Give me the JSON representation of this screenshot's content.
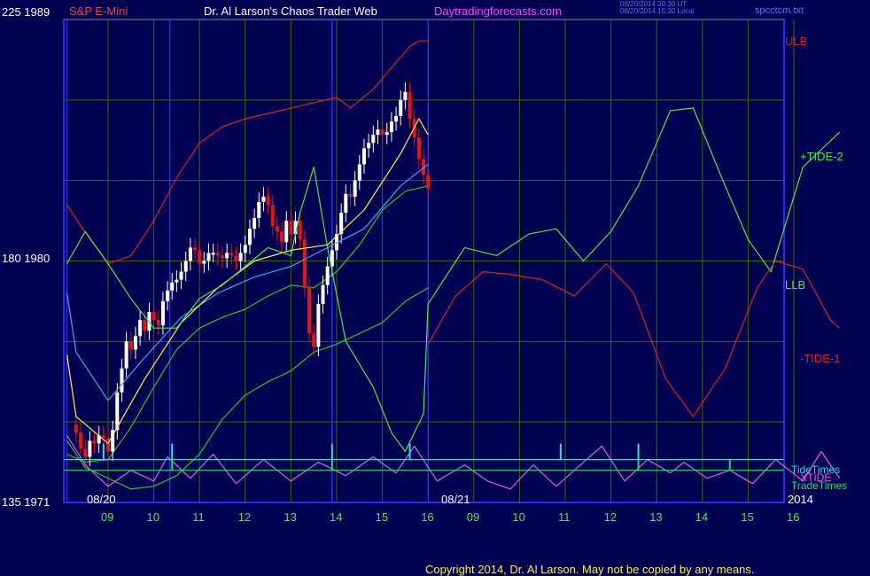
{
  "header": {
    "left_axis_top": "225  1989",
    "symbol": "S&P E-Mini",
    "site_title": "Dr. Al Larson's Chaos Trader Web",
    "site_url": "Daytradingforecasts.com",
    "timestamp_line1": "08/20/2014 20:30 UT",
    "timestamp_line2": "08/20/2014 15:30 Local",
    "file_name": "spcctcm.txt"
  },
  "axis": {
    "left_mid": "180  1980",
    "left_bottom": "135  1971",
    "date_start": "08/20",
    "date_mid": "08/21",
    "year": "2014",
    "hour_ticks": [
      "09",
      "10",
      "11",
      "12",
      "13",
      "14",
      "15",
      "16",
      "09",
      "10",
      "11",
      "12",
      "13",
      "14",
      "15",
      "16"
    ]
  },
  "right_labels": {
    "ulb": "ULB",
    "tide_plus": "+TIDE-2",
    "llb": "LLB",
    "tide_minus": "-TIDE-1",
    "tide_times": "TideTimes",
    "xtide": "XTIDE",
    "trade_times": "TradeTimes"
  },
  "footer": {
    "copyright": "Copyright 2014, Dr. Al Larson. May not be copied by any means."
  },
  "colors": {
    "background": "#000050",
    "border": "#2a2aff",
    "grid": "#3c6a00",
    "ulb": "#e02020",
    "llb": "#22cc22",
    "tide_plus": "#44ee44",
    "tide_minus": "#e02020",
    "xtide": "#ee55ee",
    "tide_times": "#33dddd",
    "trade_times": "#22dd66",
    "bar_up": "#ffffff",
    "bar_down": "#ee1111",
    "ma_fast": "#ffee44",
    "ma_slow": "#33aaff"
  },
  "chart_data": {
    "type": "line",
    "y_left_ticks": [
      "225  1989",
      "180  1980",
      "135  1971"
    ],
    "x_ticks": [
      "09",
      "10",
      "11",
      "12",
      "13",
      "14",
      "15",
      "16",
      "09",
      "10",
      "11",
      "12",
      "13",
      "14",
      "15",
      "16"
    ],
    "x_hour_index": [
      0,
      1,
      2,
      3,
      4,
      5,
      6,
      7,
      8,
      9,
      10,
      11,
      12,
      13,
      14,
      15
    ],
    "price": {
      "ylim": [
        1971,
        1989
      ],
      "candle_close_x": [
        -0.7,
        -0.6,
        -0.5,
        -0.4,
        -0.3,
        -0.2,
        -0.1,
        0.0,
        0.1,
        0.2,
        0.3,
        0.4,
        0.5,
        0.6,
        0.7,
        0.8,
        0.9,
        1.0,
        1.1,
        1.2,
        1.3,
        1.4,
        1.5,
        1.6,
        1.7,
        1.8,
        1.9,
        2.0,
        2.1,
        2.2,
        2.3,
        2.4,
        2.5,
        2.6,
        2.7,
        2.8,
        2.9,
        3.0,
        3.1,
        3.2,
        3.3,
        3.4,
        3.5,
        3.6,
        3.7,
        3.8,
        3.9,
        4.0,
        4.1,
        4.2,
        4.3,
        4.4,
        4.5,
        4.6,
        4.7,
        4.8,
        4.9,
        5.0,
        5.1,
        5.2,
        5.3,
        5.4,
        5.5,
        5.6,
        5.7,
        5.8,
        5.9,
        6.0,
        6.1,
        6.2,
        6.3,
        6.4,
        6.5,
        6.6,
        6.7,
        6.8,
        6.9,
        7.0
      ],
      "close": [
        1973.6,
        1973.0,
        1972.7,
        1973.3,
        1973.2,
        1973.5,
        1973.4,
        1972.9,
        1973.7,
        1975.1,
        1976.0,
        1977.0,
        1976.7,
        1977.2,
        1977.8,
        1977.4,
        1978.1,
        1977.8,
        1977.6,
        1978.5,
        1978.9,
        1979.2,
        1979.3,
        1979.6,
        1980.0,
        1980.5,
        1980.4,
        1979.9,
        1980.0,
        1980.3,
        1980.3,
        1980.2,
        1980.1,
        1980.3,
        1980.2,
        1980.0,
        1980.3,
        1980.6,
        1981.2,
        1981.6,
        1982.2,
        1982.4,
        1982.1,
        1981.3,
        1981.1,
        1980.7,
        1981.5,
        1981.0,
        1981.5,
        1980.8,
        1979.0,
        1977.3,
        1976.8,
        1978.4,
        1979.1,
        1979.8,
        1980.4,
        1981.0,
        1981.8,
        1982.5,
        1982.4,
        1983.0,
        1983.6,
        1984.2,
        1984.4,
        1984.7,
        1984.9,
        1984.7,
        1984.8,
        1985.2,
        1985.4,
        1986.0,
        1986.3,
        1985.3,
        1984.6,
        1983.8,
        1983.2,
        1982.7
      ],
      "ma_fast": [
        [
          -0.9,
          1976.5
        ],
        [
          -0.7,
          1974.2
        ],
        [
          0.0,
          1973.2
        ],
        [
          0.8,
          1975.6
        ],
        [
          1.6,
          1977.7
        ],
        [
          2.4,
          1979.0
        ],
        [
          3.2,
          1980.0
        ],
        [
          4.0,
          1980.4
        ],
        [
          4.8,
          1980.6
        ],
        [
          5.6,
          1981.9
        ],
        [
          6.4,
          1984.0
        ],
        [
          6.8,
          1985.3
        ],
        [
          7.0,
          1984.7
        ]
      ],
      "ma_slow": [
        [
          -0.9,
          1978.8
        ],
        [
          -0.7,
          1976.6
        ],
        [
          0.0,
          1974.8
        ],
        [
          0.8,
          1976.4
        ],
        [
          1.6,
          1977.9
        ],
        [
          2.4,
          1978.8
        ],
        [
          3.2,
          1979.4
        ],
        [
          4.0,
          1979.8
        ],
        [
          4.8,
          1980.5
        ],
        [
          5.6,
          1981.2
        ],
        [
          6.4,
          1982.8
        ],
        [
          7.0,
          1983.6
        ]
      ]
    },
    "bands": {
      "ulb": [
        [
          -0.9,
          1982.1
        ],
        [
          -0.6,
          1981.3
        ],
        [
          0.0,
          1979.9
        ],
        [
          0.5,
          1980.2
        ],
        [
          1.0,
          1981.5
        ],
        [
          1.5,
          1983.1
        ],
        [
          2.0,
          1984.4
        ],
        [
          2.5,
          1985.0
        ],
        [
          3.0,
          1985.3
        ],
        [
          3.5,
          1985.5
        ],
        [
          4.0,
          1985.7
        ],
        [
          4.5,
          1985.9
        ],
        [
          5.0,
          1986.1
        ],
        [
          5.3,
          1985.7
        ],
        [
          5.8,
          1986.4
        ],
        [
          6.2,
          1987.2
        ],
        [
          6.6,
          1988.0
        ],
        [
          6.8,
          1988.2
        ],
        [
          7.0,
          1988.2
        ]
      ],
      "llb_upper": [
        [
          -0.9,
          1972.8
        ],
        [
          -0.5,
          1972.5
        ],
        [
          0.0,
          1972.6
        ],
        [
          0.5,
          1973.8
        ],
        [
          1.0,
          1975.3
        ],
        [
          1.5,
          1976.7
        ],
        [
          2.0,
          1977.5
        ],
        [
          2.5,
          1977.9
        ],
        [
          3.0,
          1978.2
        ],
        [
          3.5,
          1978.7
        ],
        [
          4.0,
          1979.1
        ],
        [
          4.5,
          1979.0
        ],
        [
          5.0,
          1979.6
        ],
        [
          5.5,
          1980.6
        ],
        [
          6.0,
          1981.9
        ],
        [
          6.5,
          1982.6
        ],
        [
          7.0,
          1982.8
        ]
      ],
      "llb_lower": [
        [
          -0.9,
          1973.3
        ],
        [
          -0.5,
          1972.3
        ],
        [
          0.0,
          1971.9
        ],
        [
          0.5,
          1971.5
        ],
        [
          1.0,
          1971.6
        ],
        [
          1.5,
          1972.0
        ],
        [
          2.0,
          1972.8
        ],
        [
          2.5,
          1974.1
        ],
        [
          3.0,
          1975.0
        ],
        [
          3.5,
          1975.5
        ],
        [
          4.0,
          1975.9
        ],
        [
          4.5,
          1976.6
        ],
        [
          5.0,
          1976.9
        ],
        [
          5.5,
          1977.3
        ],
        [
          6.0,
          1977.7
        ],
        [
          6.5,
          1978.5
        ],
        [
          7.0,
          1979.0
        ]
      ]
    },
    "tide_plus_2": [
      [
        -0.9,
        1979.9
      ],
      [
        -0.5,
        1981.1
      ],
      [
        0.0,
        1979.9
      ],
      [
        0.5,
        1978.6
      ],
      [
        1.0,
        1977.5
      ],
      [
        1.5,
        1977.5
      ],
      [
        2.0,
        1978.6
      ],
      [
        2.5,
        1979.1
      ],
      [
        3.0,
        1979.8
      ],
      [
        3.5,
        1980.5
      ],
      [
        4.0,
        1980.2
      ],
      [
        4.2,
        1981.8
      ],
      [
        4.5,
        1983.5
      ],
      [
        4.8,
        1980.5
      ],
      [
        5.2,
        1977.0
      ],
      [
        5.8,
        1975.3
      ],
      [
        6.2,
        1973.6
      ],
      [
        6.5,
        1972.9
      ],
      [
        6.9,
        1974.3
      ],
      [
        7.0,
        1978.4
      ],
      [
        7.8,
        1980.5
      ],
      [
        8.5,
        1980.2
      ],
      [
        9.2,
        1981.0
      ],
      [
        9.8,
        1981.2
      ],
      [
        10.4,
        1980.0
      ],
      [
        11.0,
        1981.1
      ],
      [
        11.6,
        1982.8
      ],
      [
        12.3,
        1985.6
      ],
      [
        12.8,
        1985.7
      ],
      [
        13.4,
        1983.2
      ],
      [
        14.0,
        1980.8
      ],
      [
        14.5,
        1979.6
      ],
      [
        15.2,
        1983.5
      ],
      [
        16.0,
        1984.8
      ]
    ],
    "tide_minus_1": [
      [
        7.0,
        1976.9
      ],
      [
        7.6,
        1978.7
      ],
      [
        8.2,
        1979.6
      ],
      [
        8.8,
        1979.5
      ],
      [
        9.5,
        1979.3
      ],
      [
        10.2,
        1978.7
      ],
      [
        10.9,
        1979.9
      ],
      [
        11.5,
        1978.8
      ],
      [
        12.2,
        1975.6
      ],
      [
        12.8,
        1974.2
      ],
      [
        13.5,
        1976.0
      ],
      [
        14.2,
        1979.0
      ],
      [
        14.6,
        1980.0
      ],
      [
        15.2,
        1979.7
      ],
      [
        15.8,
        1977.8
      ],
      [
        16.0,
        1977.5
      ]
    ],
    "xtide": [
      [
        -0.9,
        1973.5
      ],
      [
        -0.5,
        1972.4
      ],
      [
        0.0,
        1971.6
      ],
      [
        0.5,
        1972.2
      ],
      [
        1.0,
        1971.8
      ],
      [
        1.3,
        1972.7
      ],
      [
        1.8,
        1971.9
      ],
      [
        2.3,
        1972.8
      ],
      [
        2.8,
        1971.7
      ],
      [
        3.4,
        1972.6
      ],
      [
        4.0,
        1971.8
      ],
      [
        4.6,
        1972.5
      ],
      [
        5.2,
        1972.0
      ],
      [
        5.8,
        1972.7
      ],
      [
        6.3,
        1972.1
      ],
      [
        6.7,
        1973.1
      ],
      [
        7.2,
        1971.8
      ],
      [
        7.8,
        1972.4
      ],
      [
        8.3,
        1971.8
      ],
      [
        8.8,
        1971.5
      ],
      [
        9.3,
        1972.4
      ],
      [
        9.8,
        1971.6
      ],
      [
        10.2,
        1972.2
      ],
      [
        10.8,
        1973.1
      ],
      [
        11.3,
        1971.8
      ],
      [
        11.8,
        1972.6
      ],
      [
        12.3,
        1972.1
      ],
      [
        12.6,
        1972.5
      ],
      [
        13.1,
        1971.9
      ],
      [
        13.6,
        1972.2
      ],
      [
        14.1,
        1971.7
      ],
      [
        14.6,
        1972.6
      ],
      [
        15.2,
        1971.8
      ],
      [
        15.6,
        1972.9
      ],
      [
        15.8,
        1972.4
      ],
      [
        16.0,
        1971.9
      ]
    ],
    "tide_times_level": 1972.6,
    "trade_times_level": 1972.2,
    "tide_times_spikes": [
      -0.1,
      1.4,
      4.9,
      6.6,
      9.9,
      11.6
    ],
    "trade_times_spikes": [
      1.4,
      4.9,
      11.6,
      13.6
    ]
  }
}
